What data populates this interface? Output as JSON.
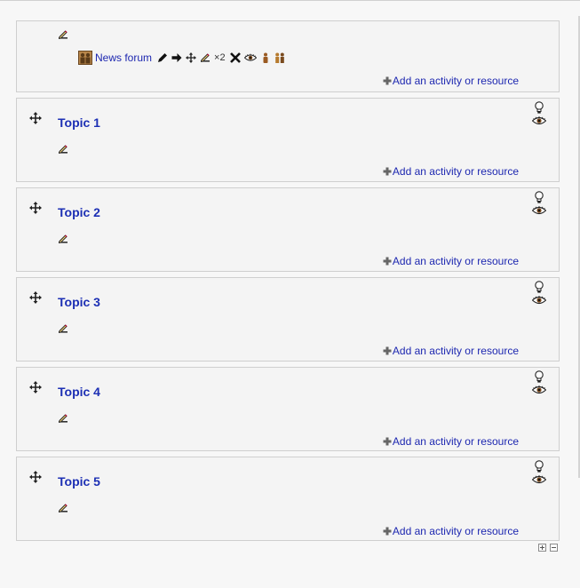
{
  "general_section": {
    "activity": {
      "name": "News forum",
      "group_mode_label": "×2"
    },
    "add_label": "Add an activity or resource"
  },
  "topics": [
    {
      "title": "Topic 1",
      "add_label": "Add an activity or resource"
    },
    {
      "title": "Topic 2",
      "add_label": "Add an activity or resource"
    },
    {
      "title": "Topic 3",
      "add_label": "Add an activity or resource"
    },
    {
      "title": "Topic 4",
      "add_label": "Add an activity or resource"
    },
    {
      "title": "Topic 5",
      "add_label": "Add an activity or resource"
    }
  ],
  "icons": {
    "move": "move-cross-icon",
    "edit": "edit-pen-icon",
    "highlight": "lightbulb-icon",
    "visibility": "eye-icon",
    "add": "plus-icon",
    "forum": "forum-icon",
    "delete": "close-icon",
    "assign_roles": "assign-roles-icon"
  },
  "colors": {
    "link": "#1d27b0",
    "title": "#1c2fb4",
    "border": "#cfcfcf"
  }
}
